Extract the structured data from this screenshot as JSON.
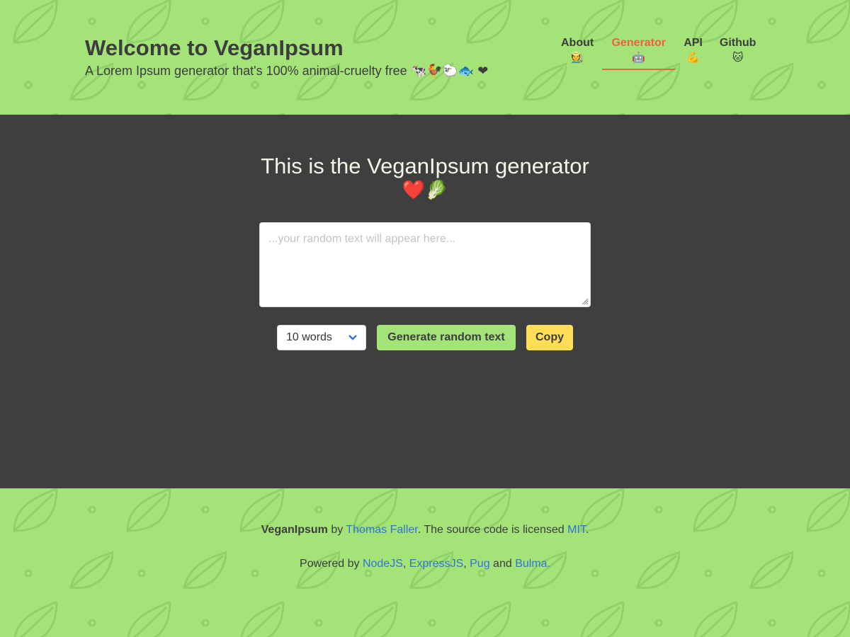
{
  "header": {
    "title": "Welcome to VeganIpsum",
    "subtitle": "A Lorem Ipsum generator that's 100% animal-cruelty free 🐄🐓🐑🐟 ❤"
  },
  "nav": [
    {
      "label": "About",
      "emoji": "🧑‍🌾"
    },
    {
      "label": "Generator",
      "emoji": "🤖"
    },
    {
      "label": "API",
      "emoji": "💪"
    },
    {
      "label": "Github",
      "emoji": "🐱"
    }
  ],
  "main": {
    "title": "This is the VeganIpsum generator",
    "title_emoji": "❤️🥬",
    "textarea_placeholder": "...your random text will appear here...",
    "select_value": "10 words",
    "generate_label": "Generate random text",
    "copy_label": "Copy"
  },
  "footer": {
    "line1": {
      "brand": "VeganIpsum",
      "by": " by ",
      "author": "Thomas Faller",
      "mid": ". The source code is licensed ",
      "license": "MIT",
      "end": "."
    },
    "line2": {
      "prefix": "Powered by ",
      "node": "NodeJS",
      "sep1": ", ",
      "express": "ExpressJS",
      "sep2": ", ",
      "pug": "Pug",
      "and": " and ",
      "bulma": "Bulma."
    }
  },
  "colors": {
    "green": "#a3e378",
    "dark": "#3f3f3f",
    "accent": "#f2613e",
    "yellow": "#ffdd57",
    "link": "#3273dc"
  }
}
